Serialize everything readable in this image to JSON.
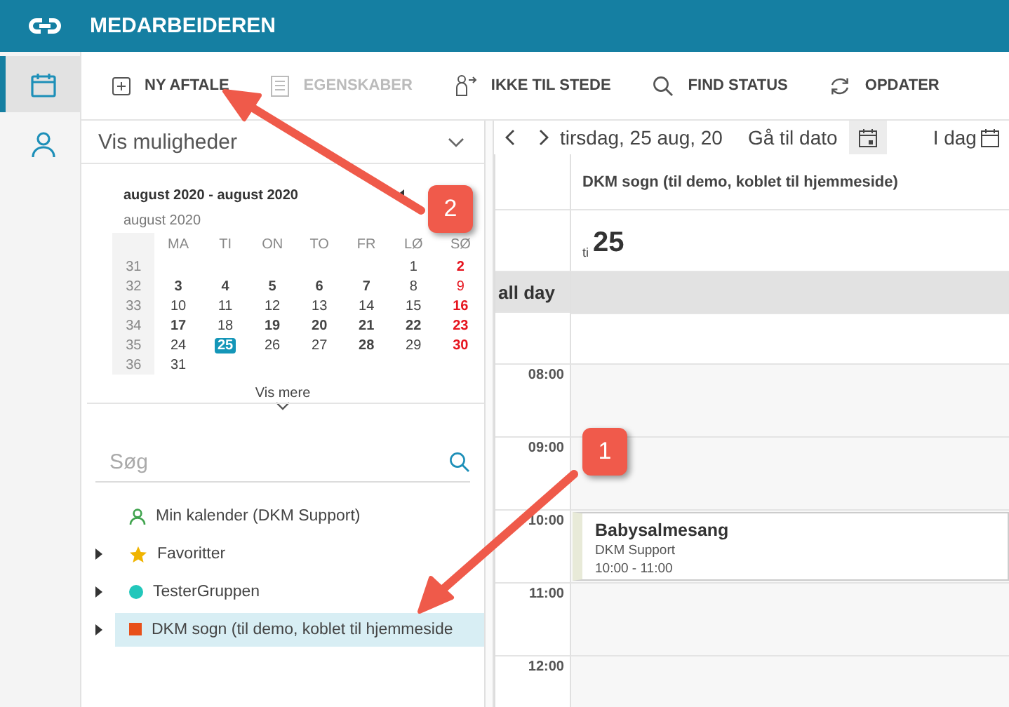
{
  "header": {
    "title": "MEDARBEIDEREN"
  },
  "rail": [
    {
      "selected": true
    },
    {
      "selected": false
    }
  ],
  "toolbar": [
    {
      "label": "NY AFTALE",
      "disabled": false
    },
    {
      "label": "EGENSKABER",
      "disabled": true
    },
    {
      "label": "IKKE TIL STEDE",
      "disabled": false
    },
    {
      "label": "FIND STATUS",
      "disabled": false
    },
    {
      "label": "OPDATER",
      "disabled": false
    }
  ],
  "options": {
    "label": "Vis muligheder"
  },
  "mini_calendar": {
    "range": "august 2020 - august 2020",
    "month": "august 2020",
    "weekdays": [
      "MA",
      "TI",
      "ON",
      "TO",
      "FR",
      "LØ",
      "SØ"
    ],
    "weeks": [
      {
        "week": "31",
        "days": [
          {
            "day": "1",
            "bold": false,
            "selected": false
          },
          {
            "day": "2",
            "bold": true,
            "selected": false
          }
        ]
      },
      {
        "week": "32",
        "days": [
          {
            "day": "3",
            "bold": true,
            "selected": false
          },
          {
            "day": "4",
            "bold": true,
            "selected": false
          },
          {
            "day": "5",
            "bold": true,
            "selected": false
          },
          {
            "day": "6",
            "bold": true,
            "selected": false
          },
          {
            "day": "7",
            "bold": true,
            "selected": false
          },
          {
            "day": "8",
            "bold": false,
            "selected": false
          },
          {
            "day": "9",
            "bold": false,
            "selected": false
          }
        ]
      },
      {
        "week": "33",
        "days": [
          {
            "day": "10",
            "bold": false,
            "selected": false
          },
          {
            "day": "11",
            "bold": false,
            "selected": false
          },
          {
            "day": "12",
            "bold": false,
            "selected": false
          },
          {
            "day": "13",
            "bold": false,
            "selected": false
          },
          {
            "day": "14",
            "bold": false,
            "selected": false
          },
          {
            "day": "15",
            "bold": false,
            "selected": false
          },
          {
            "day": "16",
            "bold": true,
            "selected": false
          }
        ]
      },
      {
        "week": "34",
        "days": [
          {
            "day": "17",
            "bold": true,
            "selected": false
          },
          {
            "day": "18",
            "bold": false,
            "selected": false
          },
          {
            "day": "19",
            "bold": true,
            "selected": false
          },
          {
            "day": "20",
            "bold": true,
            "selected": false
          },
          {
            "day": "21",
            "bold": true,
            "selected": false
          },
          {
            "day": "22",
            "bold": true,
            "selected": false
          },
          {
            "day": "23",
            "bold": true,
            "selected": false
          }
        ]
      },
      {
        "week": "35",
        "days": [
          {
            "day": "24",
            "bold": false,
            "selected": false
          },
          {
            "day": "25",
            "bold": true,
            "selected": true
          },
          {
            "day": "26",
            "bold": false,
            "selected": false
          },
          {
            "day": "27",
            "bold": false,
            "selected": false
          },
          {
            "day": "28",
            "bold": true,
            "selected": false
          },
          {
            "day": "29",
            "bold": false,
            "selected": false
          },
          {
            "day": "30",
            "bold": true,
            "selected": false
          }
        ]
      },
      {
        "week": "36",
        "days": [
          {
            "day": "31",
            "bold": false,
            "selected": false
          }
        ]
      }
    ],
    "more": "Vis mere"
  },
  "search": {
    "placeholder": "Søg"
  },
  "tree": [
    {
      "kind": "person",
      "label": "Min kalender (DKM Support)",
      "color": "#3fa34d",
      "has_children": false,
      "selected": false
    },
    {
      "kind": "star",
      "label": "Favoritter",
      "color": "#f0b400",
      "has_children": true,
      "selected": false
    },
    {
      "kind": "dot",
      "label": "TesterGruppen",
      "color": "#22c7bb",
      "has_children": true,
      "selected": false
    },
    {
      "kind": "square",
      "label": "DKM sogn (til demo, koblet til hjemmeside",
      "color": "#e8501a",
      "has_children": true,
      "selected": true
    }
  ],
  "day_view": {
    "date": "tirsdag, 25 aug, 20",
    "goto": "Gå til dato",
    "today": "I dag",
    "column_title": "DKM sogn (til demo, koblet til hjemmeside)",
    "day_abbr": "ti",
    "day_number": "25",
    "all_day": "all day",
    "hours": [
      {
        "time": "08:00"
      },
      {
        "time": "09:00"
      },
      {
        "time": "10:00",
        "event": {
          "title": "Babysalmesang",
          "owner": "DKM Support",
          "time": "10:00 - 11:00"
        }
      },
      {
        "time": "11:00"
      },
      {
        "time": "12:00"
      }
    ]
  },
  "annotations": [
    {
      "label": "2"
    },
    {
      "label": "1"
    }
  ]
}
